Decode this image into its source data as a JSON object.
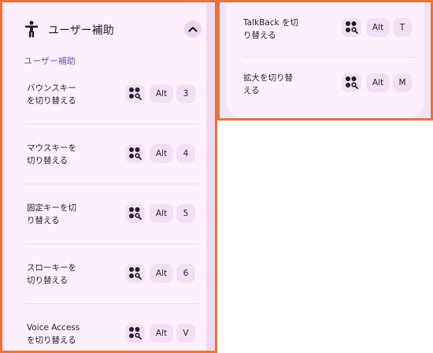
{
  "header": {
    "title": "ユーザー補助"
  },
  "section_title": "ユーザー補助",
  "left_rows": [
    {
      "label_lines": [
        "バウンスキー",
        "を切り替える"
      ],
      "keys": [
        "Alt",
        "3"
      ]
    },
    {
      "label_lines": [
        "マウスキーを",
        "切り替える"
      ],
      "keys": [
        "Alt",
        "4"
      ]
    },
    {
      "label_lines": [
        "固定キーを切",
        "り替える"
      ],
      "keys": [
        "Alt",
        "5"
      ]
    },
    {
      "label_lines": [
        "スローキーを",
        "切り替える"
      ],
      "keys": [
        "Alt",
        "6"
      ]
    },
    {
      "label_lines": [
        "Voice Access",
        "を切り替える"
      ],
      "keys": [
        "Alt",
        "V"
      ]
    }
  ],
  "right_rows": [
    {
      "label_lines": [
        "TalkBack を切",
        "り替える"
      ],
      "keys": [
        "Alt",
        "T"
      ]
    },
    {
      "label_lines": [
        "拡大を切り替",
        "える"
      ],
      "keys": [
        "Alt",
        "M"
      ]
    }
  ],
  "icons": {
    "header": "accessibility-person-icon",
    "collapse": "chevron-up-icon",
    "launcher": "launcher-search-icon"
  },
  "colors": {
    "accent_border": "#e8743b",
    "section_title": "#7b4fae",
    "key_background": "#f2dff6",
    "panel_background": "#fdf0fc"
  }
}
